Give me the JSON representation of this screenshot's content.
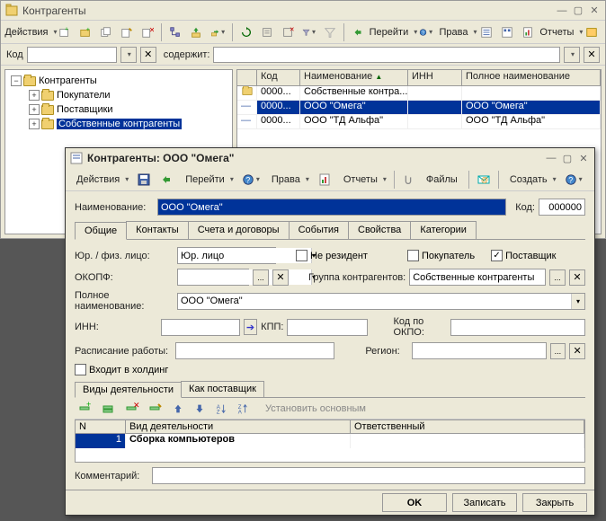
{
  "main": {
    "title": "Контрагенты",
    "toolbar": {
      "actions": "Действия",
      "go": "Перейти",
      "rights": "Права",
      "reports": "Отчеты"
    },
    "search": {
      "kod_label": "Код",
      "contains_label": "содержит:"
    },
    "tree": {
      "root": "Контрагенты",
      "items": [
        "Покупатели",
        "Поставщики",
        "Собственные контрагенты"
      ]
    },
    "grid": {
      "headers": {
        "kod": "Код",
        "name": "Наименование",
        "inn": "ИНН",
        "full": "Полное наименование"
      },
      "rows": [
        {
          "kod": "0000...",
          "name": "Собственные контра...",
          "inn": "",
          "full": "",
          "folder": true
        },
        {
          "kod": "0000...",
          "name": "ООО \"Омега\"",
          "inn": "",
          "full": "ООО \"Омега\"",
          "sel": true
        },
        {
          "kod": "0000...",
          "name": "ООО \"ТД Альфа\"",
          "inn": "",
          "full": "ООО \"ТД Альфа\""
        }
      ]
    }
  },
  "dialog": {
    "title": "Контрагенты: ООО \"Омега\"",
    "toolbar": {
      "actions": "Действия",
      "go": "Перейти",
      "rights": "Права",
      "reports": "Отчеты",
      "files": "Файлы",
      "create": "Создать"
    },
    "form": {
      "name_label": "Наименование:",
      "name_value": "ООО \"Омега\"",
      "kod_label": "Код:",
      "kod_value": "000000"
    },
    "tabs": [
      "Общие",
      "Контакты",
      "Счета и договоры",
      "События",
      "Свойства",
      "Категории"
    ],
    "general": {
      "entity_label": "Юр. / физ. лицо:",
      "entity_value": "Юр. лицо",
      "nonresident": "Не резидент",
      "buyer": "Покупатель",
      "supplier": "Поставщик",
      "okopf_label": "ОКОПФ:",
      "group_label": "Группа контрагентов:",
      "group_value": "Собственные контрагенты",
      "fullname_label": "Полное наименование:",
      "fullname_value": "ООО \"Омега\"",
      "inn_label": "ИНН:",
      "kpp_label": "КПП:",
      "okpo_label": "Код по ОКПО:",
      "schedule_label": "Расписание работы:",
      "region_label": "Регион:",
      "holding": "Входит в холдинг"
    },
    "subtabs": [
      "Виды деятельности",
      "Как поставщик"
    ],
    "subtoolbar": {
      "setmain": "Установить основным"
    },
    "activity": {
      "headers": {
        "n": "N",
        "vid": "Вид деятельности",
        "resp": "Ответственный"
      },
      "row": {
        "n": "1",
        "vid": "Сборка компьютеров",
        "resp": ""
      }
    },
    "comment_label": "Комментарий:",
    "footer": {
      "ok": "OK",
      "save": "Записать",
      "close": "Закрыть"
    }
  }
}
